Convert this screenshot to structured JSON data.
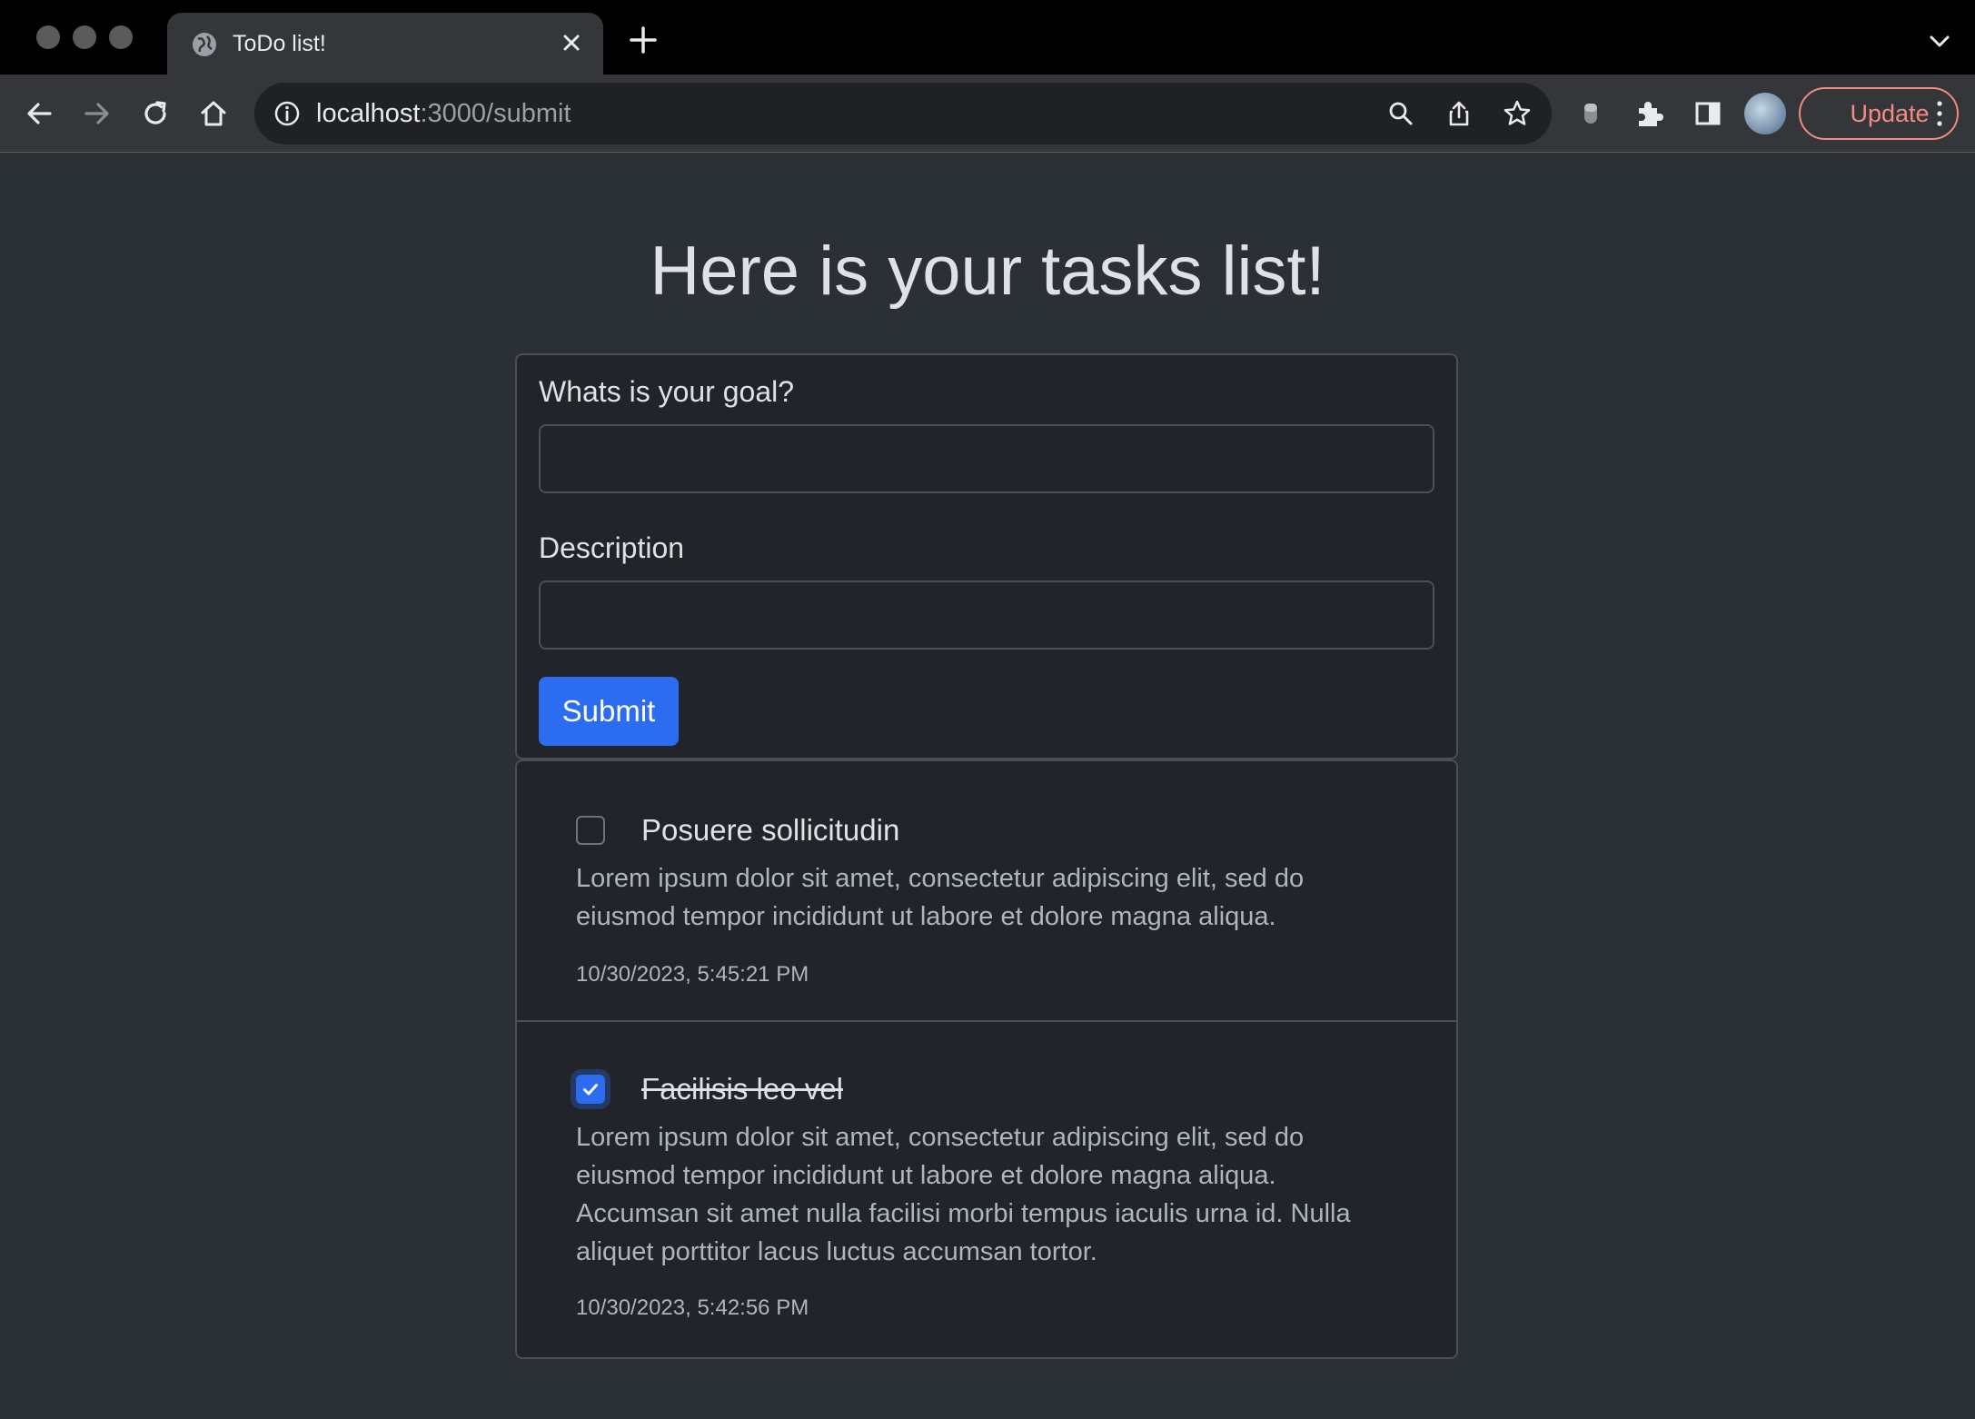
{
  "browser": {
    "tab_title": "ToDo list!",
    "url_host": "localhost",
    "url_rest": ":3000/submit",
    "update_label": "Update"
  },
  "page": {
    "heading": "Here is your tasks list!",
    "form": {
      "goal_label": "Whats is your goal?",
      "goal_value": "",
      "description_label": "Description",
      "description_value": "",
      "submit_label": "Submit"
    },
    "tasks": [
      {
        "title": "Posuere sollicitudin",
        "description": "Lorem ipsum dolor sit amet, consectetur adipiscing elit, sed do eiusmod tempor incididunt ut labore et dolore magna aliqua.",
        "timestamp": "10/30/2023, 5:45:21 PM",
        "completed": false
      },
      {
        "title": "Facilisis leo vel",
        "description": "Lorem ipsum dolor sit amet, consectetur adipiscing elit, sed do eiusmod tempor incididunt ut labore et dolore magna aliqua. Accumsan sit amet nulla facilisi morbi tempus iaculis urna id. Nulla aliquet porttitor lacus luctus accumsan tortor.",
        "timestamp": "10/30/2023, 5:42:56 PM",
        "completed": true
      }
    ]
  },
  "colors": {
    "accent": "#2b6cf0",
    "page_bg": "#2b3035",
    "card_bg": "#212529",
    "update_accent": "#f28b82"
  }
}
